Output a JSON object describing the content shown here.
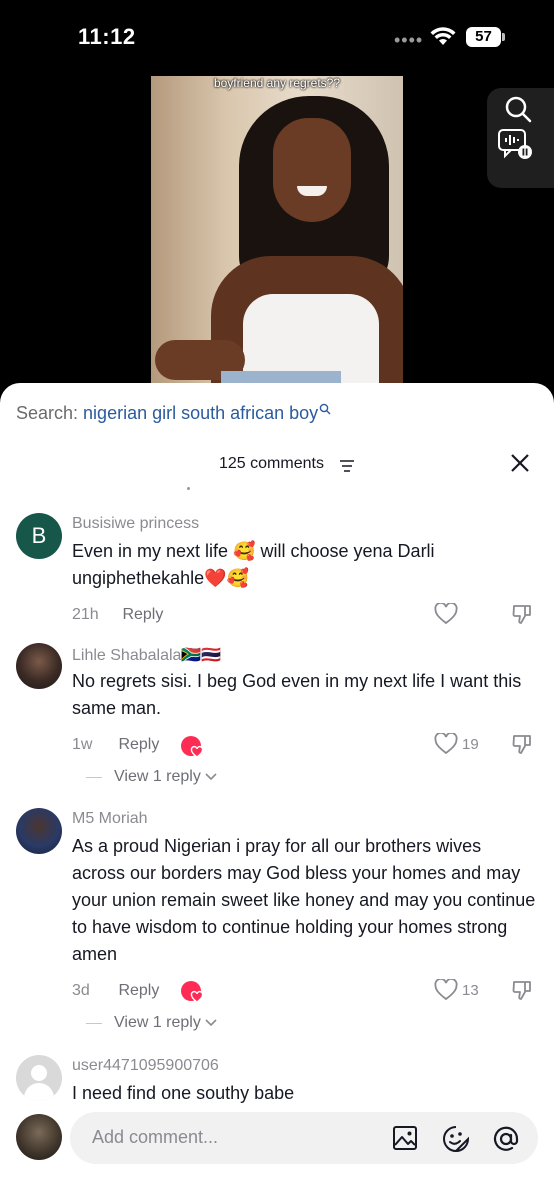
{
  "status_bar": {
    "time": "11:12",
    "battery": "57"
  },
  "video": {
    "caption": "boyfriend any regrets??"
  },
  "search": {
    "label": "Search: ",
    "query": "nigerian girl south african boy"
  },
  "header": {
    "comment_count": "125 comments"
  },
  "comments": [
    {
      "username": "Busisiwe princess",
      "avatar_letter": "B",
      "text": "Even in my next life 🥰 will choose yena Darli ungiphethekahle❤️🥰",
      "time": "21h",
      "reply_label": "Reply",
      "likes": ""
    },
    {
      "username": "Lihle Shabalala🇿🇦🇹🇭",
      "text": "No regrets sisi. I beg God even in my next life I want this same man.",
      "time": "1w",
      "reply_label": "Reply",
      "likes": "19",
      "view_replies": "View 1 reply"
    },
    {
      "username": "M5 Moriah",
      "text": "As a proud Nigerian i pray for all our brothers wives across our borders may God bless your homes and may your union remain sweet like honey and may you continue to have wisdom to continue holding your homes strong amen",
      "time": "3d",
      "reply_label": "Reply",
      "likes": "13",
      "view_replies": "View 1 reply"
    },
    {
      "username": "user4471095900706",
      "text": "I need find one southy babe"
    }
  ],
  "input": {
    "placeholder": "Add comment..."
  },
  "colors": {
    "search_query": "#2b5b9f",
    "creator_heart": "#fe2c55"
  }
}
